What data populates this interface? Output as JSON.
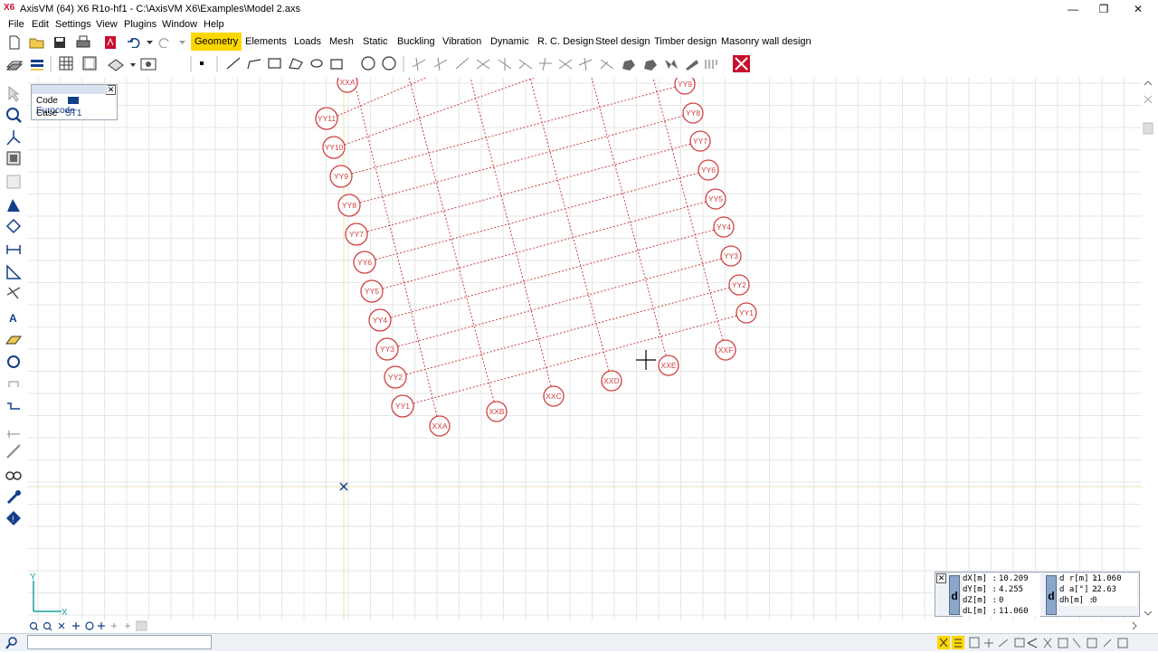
{
  "window": {
    "title": "AxisVM (64) X6 R1o-hf1 - C:\\AxisVM X6\\Examples\\Model 2.axs",
    "icon": "X6",
    "minimize": "—",
    "maximize": "❐",
    "close": "✕"
  },
  "menu": [
    "File",
    "Edit",
    "Settings",
    "View",
    "Plugins",
    "Window",
    "Help"
  ],
  "tabs": [
    {
      "label": "Geometry",
      "active": true
    },
    {
      "label": "Elements"
    },
    {
      "label": "Loads"
    },
    {
      "label": "Mesh"
    },
    {
      "label": "Static"
    },
    {
      "label": "Buckling"
    },
    {
      "label": "Vibration"
    },
    {
      "label": "Dynamic"
    },
    {
      "label": "R. C. Design"
    },
    {
      "label": "Steel design"
    },
    {
      "label": "Timber design"
    },
    {
      "label": "Masonry wall design"
    }
  ],
  "infobox": {
    "code_label": "Code",
    "code_value": "Eurocode",
    "case_label": "Case",
    "case_value": "ST1"
  },
  "grid_labels": {
    "yy_left": [
      "YY11",
      "YY10",
      "YY9",
      "YY8",
      "YY7",
      "YY6",
      "YY5",
      "YY4",
      "YY3",
      "YY2",
      "YY1"
    ],
    "yy_right": [
      "YY9",
      "YY8",
      "YY7",
      "YY6",
      "YY5",
      "YY4",
      "YY3",
      "YY2",
      "YY1"
    ],
    "xx_bottom": [
      "XXA",
      "XXB",
      "XXC",
      "XXD",
      "XXE",
      "XXF"
    ],
    "xx_top": [
      "XXA"
    ]
  },
  "axes": {
    "y": "Y",
    "x": "X"
  },
  "coords": {
    "dX_label": "dX[m] :",
    "dX": "10.209",
    "dY_label": "dY[m] :",
    "dY": "4.255",
    "dZ_label": "dZ[m] :",
    "dZ": "0",
    "dL_label": "dL[m] :",
    "dL": "11.060",
    "dr_label": "d r[m] :",
    "dr": "11.060",
    "da_label": "d a[°] :",
    "da": "22.63",
    "dh_label": "dh[m] :",
    "dh": "0",
    "d_label": "d"
  },
  "colors": {
    "grid_red": "#d04040",
    "accent_yellow": "#ffd700",
    "bg": "#ffffff"
  }
}
